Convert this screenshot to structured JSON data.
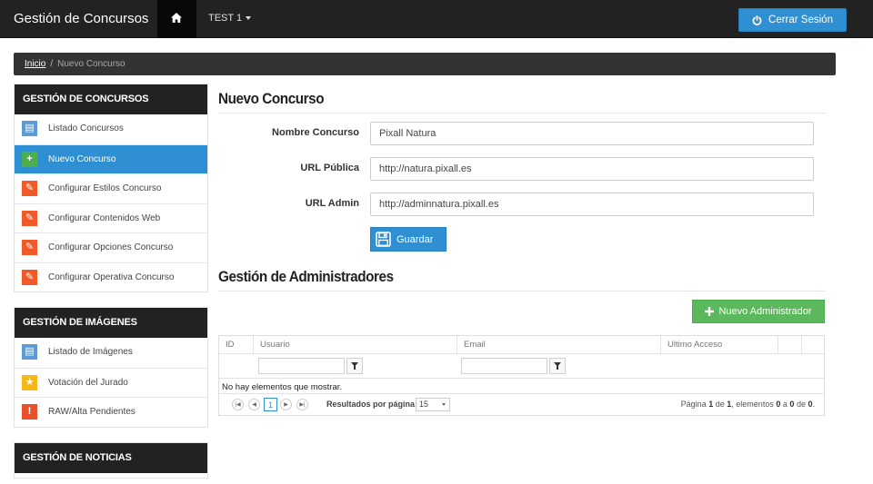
{
  "navbar": {
    "brand": "Gestión de Concursos",
    "home_icon": "home-icon",
    "project_menu": "TEST 1",
    "logout_label": "Cerrar Sesión",
    "logout_icon": "power-icon"
  },
  "breadcrumb": {
    "home": "Inicio",
    "separator": "/",
    "current": "Nuevo Concurso"
  },
  "sidebar": {
    "contests": {
      "title": "GESTIÓN DE CONCURSOS",
      "items": [
        {
          "label": "Listado Concursos",
          "icon": "document-icon",
          "glyph": "▤"
        },
        {
          "label": "Nuevo Concurso",
          "icon": "plus-icon",
          "glyph": "+",
          "active": true
        },
        {
          "label": "Configurar Estilos Concurso",
          "icon": "wrench-icon",
          "glyph": "✎"
        },
        {
          "label": "Configurar Contenidos Web",
          "icon": "wrench-icon",
          "glyph": "✎"
        },
        {
          "label": "Configurar Opciones Concurso",
          "icon": "wrench-icon",
          "glyph": "✎"
        },
        {
          "label": "Configurar Operativa Concurso",
          "icon": "wrench-icon",
          "glyph": "✎"
        }
      ]
    },
    "images": {
      "title": "GESTIÓN DE IMÁGENES",
      "items": [
        {
          "label": "Listado de Imágenes",
          "icon": "document-icon",
          "glyph": "▤"
        },
        {
          "label": "Votación del Jurado",
          "icon": "star-icon",
          "glyph": "★"
        },
        {
          "label": "RAW/Alta Pendientes",
          "icon": "warning-icon",
          "glyph": "!"
        }
      ]
    },
    "news": {
      "title": "GESTIÓN DE NOTICIAS"
    }
  },
  "form": {
    "title": "Nuevo Concurso",
    "fields": [
      {
        "label": "Nombre Concurso",
        "value": "Pixall Natura"
      },
      {
        "label": "URL Pública",
        "value": "http://natura.pixall.es"
      },
      {
        "label": "URL Admin",
        "value": "http://adminnatura.pixall.es"
      }
    ],
    "save_label": "Guardar",
    "save_icon": "floppy-disk-icon"
  },
  "admins": {
    "title": "Gestión de Administradores",
    "add_button": "Nuevo Administrador",
    "add_icon": "plus-icon",
    "columns": [
      "ID",
      "Usuario",
      "Email",
      "Ultimo Acceso"
    ],
    "empty_message": "No hay elementos que mostrar.",
    "pager": {
      "current_page": "1",
      "page_size_label": "Resultados por página:",
      "page_size": "15",
      "info_prefix": "Página",
      "info_page": "1",
      "info_of": "de",
      "info_total_pages": "1",
      "info_items": ", elementos",
      "info_from": "0",
      "info_a": "a",
      "info_to": "0",
      "info_de": "de",
      "info_total": "0",
      "info_end": "."
    }
  },
  "colors": {
    "accent": "#2e8fd2",
    "success": "#5cb85c",
    "dark": "#222222",
    "warning": "#f05a28"
  }
}
